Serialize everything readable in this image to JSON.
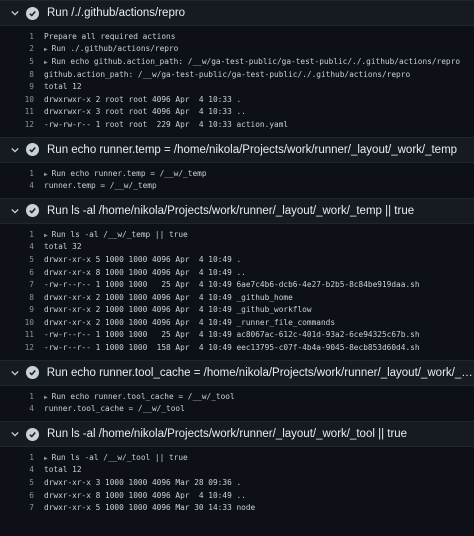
{
  "steps": [
    {
      "title": "Run /./.github/actions/repro",
      "lines": [
        {
          "n": "1",
          "text": "Prepare all required actions"
        },
        {
          "n": "2",
          "text": "Run ./.github/actions/repro",
          "group": true
        },
        {
          "n": "5",
          "text": "Run echo github.action_path: /__w/ga-test-public/ga-test-public/./.github/actions/repro",
          "group": true
        },
        {
          "n": "8",
          "text": "github.action_path: /__w/ga-test-public/ga-test-public/./.github/actions/repro"
        },
        {
          "n": "9",
          "text": "total 12"
        },
        {
          "n": "10",
          "text": "drwxrwxr-x 2 root root 4096 Apr  4 10:33 ."
        },
        {
          "n": "11",
          "text": "drwxrwxr-x 3 root root 4096 Apr  4 10:33 .."
        },
        {
          "n": "12",
          "text": "-rw-rw-r-- 1 root root  229 Apr  4 10:33 action.yaml"
        }
      ]
    },
    {
      "title": "Run echo runner.temp = /home/nikola/Projects/work/runner/_layout/_work/_temp",
      "lines": [
        {
          "n": "1",
          "text": "Run echo runner.temp = /__w/_temp",
          "group": true
        },
        {
          "n": "4",
          "text": "runner.temp = /__w/_temp"
        }
      ]
    },
    {
      "title": "Run ls -al /home/nikola/Projects/work/runner/_layout/_work/_temp || true",
      "lines": [
        {
          "n": "1",
          "text": "Run ls -al /__w/_temp || true",
          "group": true
        },
        {
          "n": "4",
          "text": "total 32"
        },
        {
          "n": "5",
          "text": "drwxr-xr-x 5 1000 1000 4096 Apr  4 10:49 ."
        },
        {
          "n": "6",
          "text": "drwxr-xr-x 8 1000 1000 4096 Apr  4 10:49 .."
        },
        {
          "n": "7",
          "text": "-rw-r--r-- 1 1000 1000   25 Apr  4 10:49 6ae7c4b6-dcb6-4e27-b2b5-8c84be919daa.sh"
        },
        {
          "n": "8",
          "text": "drwxr-xr-x 2 1000 1000 4096 Apr  4 10:49 _github_home"
        },
        {
          "n": "9",
          "text": "drwxr-xr-x 2 1000 1000 4096 Apr  4 10:49 _github_workflow"
        },
        {
          "n": "10",
          "text": "drwxr-xr-x 2 1000 1000 4096 Apr  4 10:49 _runner_file_commands"
        },
        {
          "n": "11",
          "text": "-rw-r--r-- 1 1000 1000   25 Apr  4 10:49 ac8067ac-612c-401d-93a2-6ce94325c67b.sh"
        },
        {
          "n": "12",
          "text": "-rw-r--r-- 1 1000 1000  158 Apr  4 10:49 eec13795-c07f-4b4a-9045-8ecb853d60d4.sh"
        }
      ]
    },
    {
      "title": "Run echo runner.tool_cache = /home/nikola/Projects/work/runner/_layout/_work/_tool",
      "lines": [
        {
          "n": "1",
          "text": "Run echo runner.tool_cache = /__w/_tool",
          "group": true
        },
        {
          "n": "4",
          "text": "runner.tool_cache = /__w/_tool"
        }
      ]
    },
    {
      "title": "Run ls -al /home/nikola/Projects/work/runner/_layout/_work/_tool || true",
      "lines": [
        {
          "n": "1",
          "text": "Run ls -al /__w/_tool || true",
          "group": true
        },
        {
          "n": "4",
          "text": "total 12"
        },
        {
          "n": "5",
          "text": "drwxr-xr-x 3 1000 1000 4096 Mar 28 09:36 ."
        },
        {
          "n": "6",
          "text": "drwxr-xr-x 8 1000 1000 4096 Apr  4 10:49 .."
        },
        {
          "n": "7",
          "text": "drwxr-xr-x 5 1000 1000 4096 Mar 30 14:33 node"
        }
      ]
    }
  ]
}
